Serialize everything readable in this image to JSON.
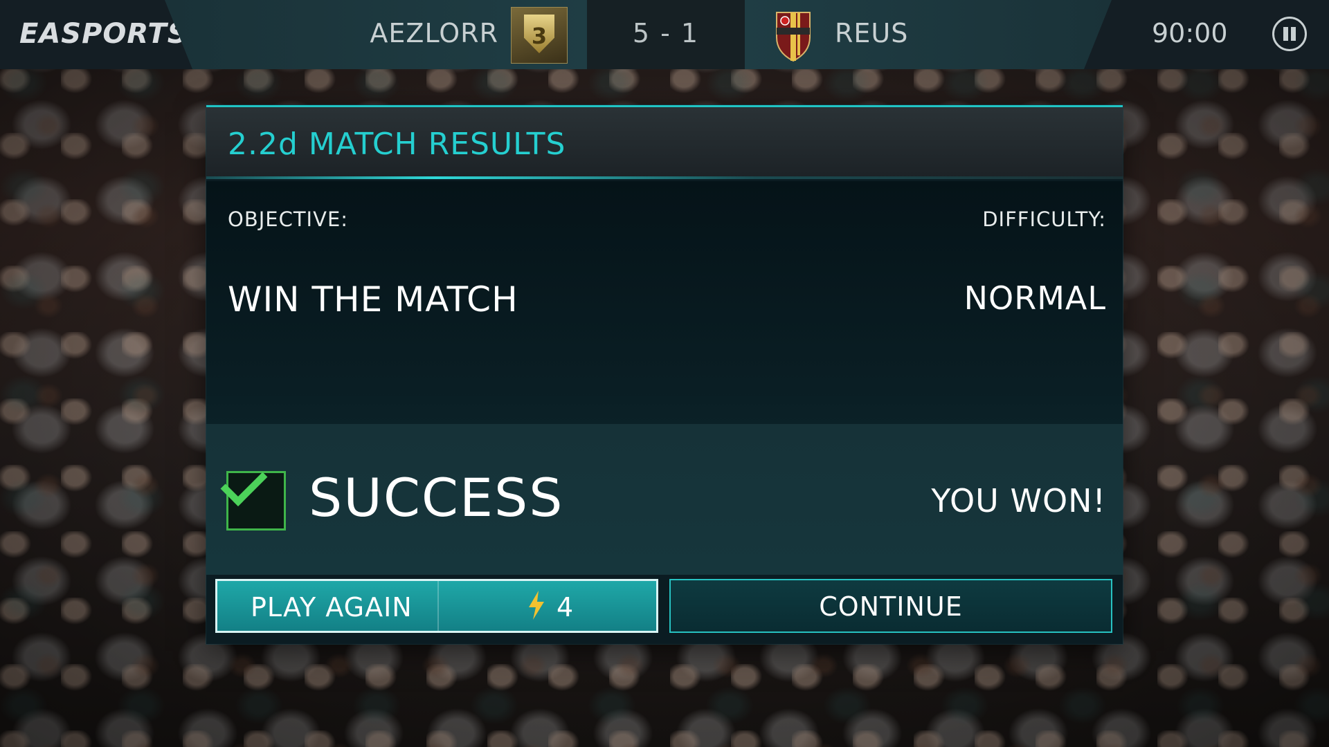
{
  "hud": {
    "brand": "EASPORTS",
    "home_team": "AEZLORR",
    "home_badge_level": "3",
    "score": "5 - 1",
    "away_team": "REUS",
    "timer": "90:00"
  },
  "modal": {
    "title": "2.2d MATCH RESULTS",
    "objective_label": "OBJECTIVE:",
    "objective_value": "WIN THE MATCH",
    "difficulty_label": "DIFFICULTY:",
    "difficulty_value": "NORMAL",
    "result_status": "SUCCESS",
    "result_message": "YOU WON!"
  },
  "buttons": {
    "play_again_label": "PLAY AGAIN",
    "play_again_energy_cost": "4",
    "continue_label": "CONTINUE"
  },
  "colors": {
    "accent": "#25cfd0",
    "success": "#4cd25a"
  }
}
